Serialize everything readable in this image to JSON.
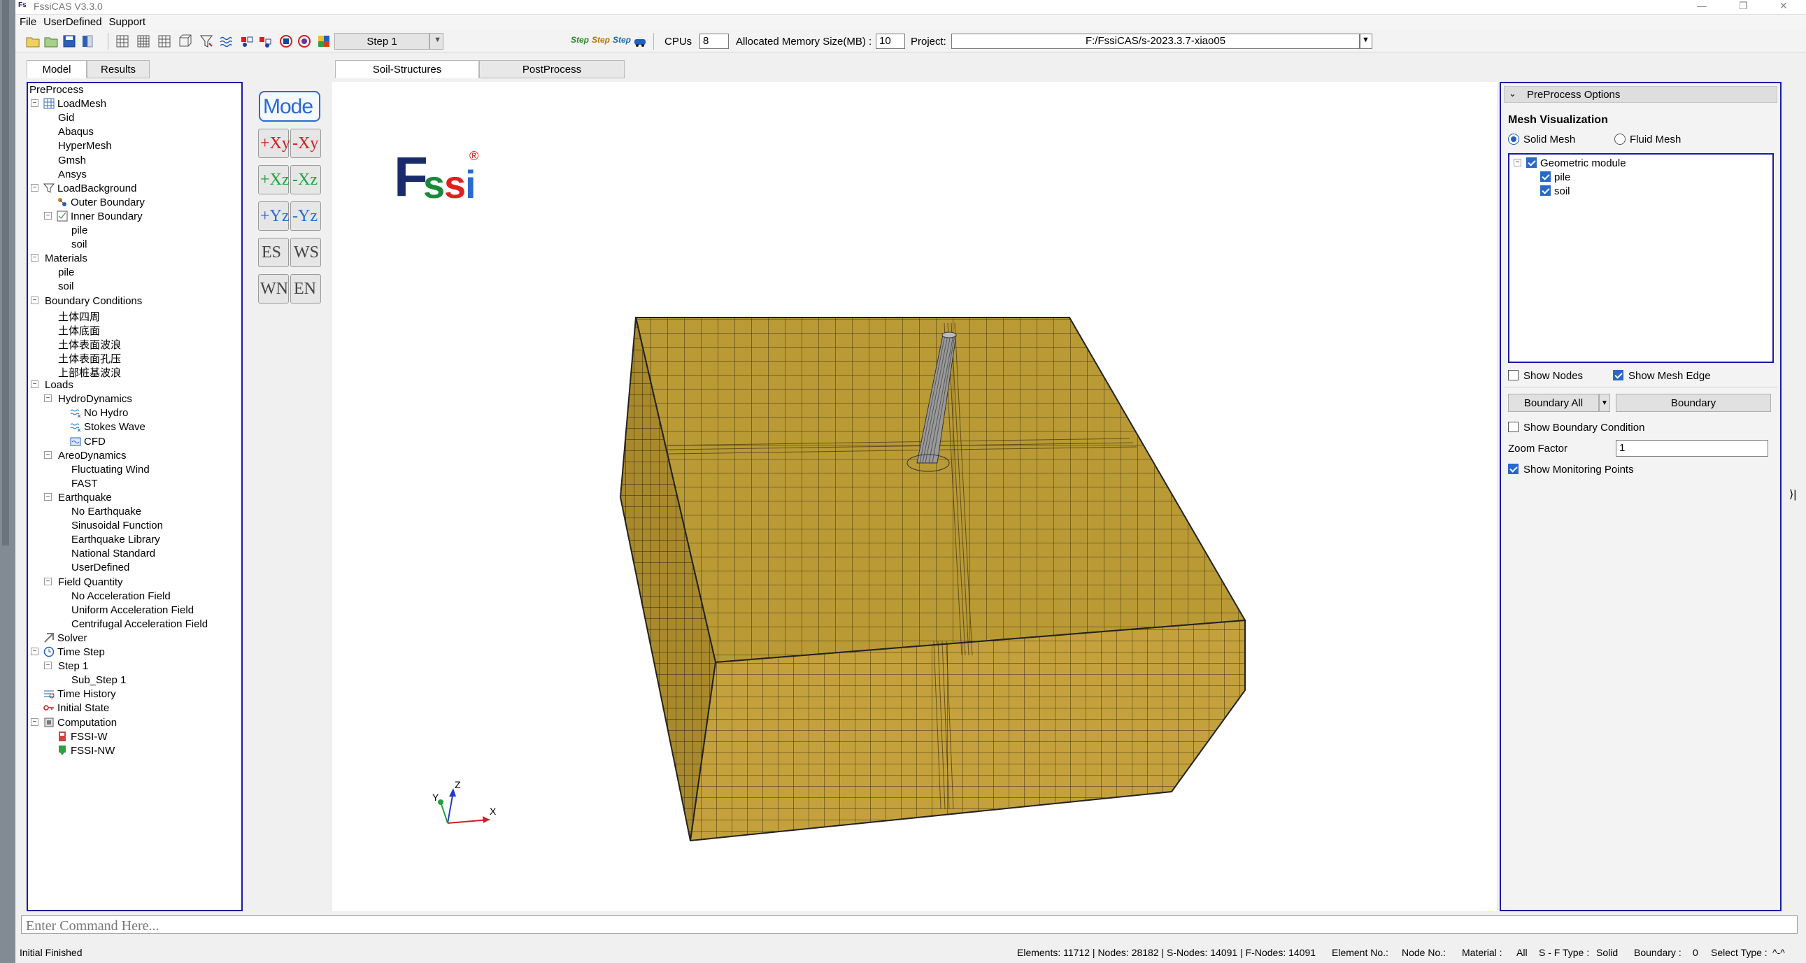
{
  "app": {
    "title": "FssiCAS V3.3.0"
  },
  "menu": [
    "File",
    "UserDefined",
    "Support"
  ],
  "toolbar": {
    "step_combo": "Step 1",
    "step_icons": [
      "Step",
      "Step",
      "Step"
    ],
    "cpus_label": "CPUs",
    "cpus_value": "8",
    "memory_label": "Allocated Memory Size(MB) :",
    "memory_value": "10",
    "project_label": "Project:",
    "project_path": "F:/FssiCAS/s-2023.3.7-xiao05"
  },
  "left_tabs": [
    "Model",
    "Results"
  ],
  "tree": [
    {
      "label": "PreProcess",
      "depth": 0,
      "exp": "",
      "icon": ""
    },
    {
      "label": "LoadMesh",
      "depth": 1,
      "exp": "-",
      "icon": "mesh-icon"
    },
    {
      "label": "Gid",
      "depth": 2,
      "exp": "",
      "icon": ""
    },
    {
      "label": "Abaqus",
      "depth": 2,
      "exp": "",
      "icon": ""
    },
    {
      "label": "HyperMesh",
      "depth": 2,
      "exp": "",
      "icon": ""
    },
    {
      "label": "Gmsh",
      "depth": 2,
      "exp": "",
      "icon": ""
    },
    {
      "label": "Ansys",
      "depth": 2,
      "exp": "",
      "icon": ""
    },
    {
      "label": "LoadBackground",
      "depth": 1,
      "exp": "-",
      "icon": "funnel-icon"
    },
    {
      "label": "Outer Boundary",
      "depth": 2,
      "exp": "",
      "icon": "boundary-icon"
    },
    {
      "label": "Inner Boundary",
      "depth": 2,
      "exp": "-",
      "icon": "inner-boundary-icon"
    },
    {
      "label": "pile",
      "depth": 3,
      "exp": "",
      "icon": ""
    },
    {
      "label": "soil",
      "depth": 3,
      "exp": "",
      "icon": ""
    },
    {
      "label": "Materials",
      "depth": 1,
      "exp": "-",
      "icon": ""
    },
    {
      "label": "pile",
      "depth": 2,
      "exp": "",
      "icon": ""
    },
    {
      "label": "soil",
      "depth": 2,
      "exp": "",
      "icon": ""
    },
    {
      "label": "Boundary Conditions",
      "depth": 1,
      "exp": "-",
      "icon": ""
    },
    {
      "label": "土体四周",
      "depth": 2,
      "exp": "",
      "icon": ""
    },
    {
      "label": "土体底面",
      "depth": 2,
      "exp": "",
      "icon": ""
    },
    {
      "label": "土体表面波浪",
      "depth": 2,
      "exp": "",
      "icon": ""
    },
    {
      "label": "土体表面孔压",
      "depth": 2,
      "exp": "",
      "icon": ""
    },
    {
      "label": "上部桩基波浪",
      "depth": 2,
      "exp": "",
      "icon": ""
    },
    {
      "label": "Loads",
      "depth": 1,
      "exp": "-",
      "icon": ""
    },
    {
      "label": "HydroDynamics",
      "depth": 2,
      "exp": "-",
      "icon": ""
    },
    {
      "label": "No Hydro",
      "depth": 3,
      "exp": "",
      "icon": "wave-icon"
    },
    {
      "label": "Stokes Wave",
      "depth": 3,
      "exp": "",
      "icon": "wave-icon"
    },
    {
      "label": "CFD",
      "depth": 3,
      "exp": "",
      "icon": "cfd-icon"
    },
    {
      "label": "AreoDynamics",
      "depth": 2,
      "exp": "-",
      "icon": ""
    },
    {
      "label": "Fluctuating Wind",
      "depth": 3,
      "exp": "",
      "icon": ""
    },
    {
      "label": "FAST",
      "depth": 3,
      "exp": "",
      "icon": ""
    },
    {
      "label": "Earthquake",
      "depth": 2,
      "exp": "-",
      "icon": ""
    },
    {
      "label": "No Earthquake",
      "depth": 3,
      "exp": "",
      "icon": ""
    },
    {
      "label": "Sinusoidal Function",
      "depth": 3,
      "exp": "",
      "icon": ""
    },
    {
      "label": "Earthquake Library",
      "depth": 3,
      "exp": "",
      "icon": ""
    },
    {
      "label": "National Standard",
      "depth": 3,
      "exp": "",
      "icon": ""
    },
    {
      "label": "UserDefined",
      "depth": 3,
      "exp": "",
      "icon": ""
    },
    {
      "label": "Field Quantity",
      "depth": 2,
      "exp": "-",
      "icon": ""
    },
    {
      "label": "No Acceleration Field",
      "depth": 3,
      "exp": "",
      "icon": ""
    },
    {
      "label": "Uniform Acceleration Field",
      "depth": 3,
      "exp": "",
      "icon": ""
    },
    {
      "label": "Centrifugal Acceleration Field",
      "depth": 3,
      "exp": "",
      "icon": ""
    },
    {
      "label": "Solver",
      "depth": 1,
      "exp": "",
      "icon": "solver-icon"
    },
    {
      "label": "Time Step",
      "depth": 1,
      "exp": "-",
      "icon": "clock-icon"
    },
    {
      "label": "Step 1",
      "depth": 2,
      "exp": "-",
      "icon": ""
    },
    {
      "label": "Sub_Step 1",
      "depth": 3,
      "exp": "",
      "icon": ""
    },
    {
      "label": "Time History",
      "depth": 1,
      "exp": "",
      "icon": "history-icon"
    },
    {
      "label": "Initial State",
      "depth": 1,
      "exp": "",
      "icon": "key-icon"
    },
    {
      "label": "Computation",
      "depth": 1,
      "exp": "-",
      "icon": "computation-icon"
    },
    {
      "label": "FSSI-W",
      "depth": 2,
      "exp": "",
      "icon": "fssi-w-icon"
    },
    {
      "label": "FSSI-NW",
      "depth": 2,
      "exp": "",
      "icon": "fssi-nw-icon"
    }
  ],
  "view_buttons": {
    "model": "Mode",
    "pairs": [
      [
        "+Xy",
        "-Xy"
      ],
      [
        "+Xz",
        "-Xz"
      ],
      [
        "+Yz",
        "-Yz"
      ],
      [
        "ES",
        "WS"
      ],
      [
        "WN",
        "EN"
      ]
    ]
  },
  "view_tabs": [
    "Soil-Structures",
    "PostProcess"
  ],
  "logo": {
    "text_f": "F",
    "text_s1": "s",
    "text_s2": "s",
    "text_i": "i",
    "mark": "®"
  },
  "axes": {
    "x": "X",
    "y": "Y",
    "z": "Z"
  },
  "right_panel": {
    "header": "PreProcess Options",
    "section_title": "Mesh Visualization",
    "radio_solid": "Solid Mesh",
    "radio_fluid": "Fluid Mesh",
    "geo_tree": {
      "root": "Geometric module",
      "children": [
        "pile",
        "soil"
      ]
    },
    "show_nodes": "Show Nodes",
    "show_mesh_edge": "Show Mesh Edge",
    "boundary_all": "Boundary All",
    "boundary_btn": "Boundary",
    "show_boundary_condition": "Show Boundary Condition",
    "zoom_label": "Zoom Factor",
    "zoom_value": "1",
    "show_monitoring": "Show Monitoring Points"
  },
  "command": {
    "placeholder": "Enter Command Here..."
  },
  "status": {
    "message": "Initial Finished",
    "stats": "Elements: 11712 | Nodes: 28182 | S-Nodes: 14091 | F-Nodes: 14091",
    "element_no": "Element No.:",
    "node_no": "Node No.:",
    "material": "Material :",
    "material_value": "All",
    "sf_type": "S - F Type :",
    "sf_value": "Solid",
    "boundary": "Boundary :",
    "boundary_value": "0",
    "select_type": "Select Type :",
    "select_value": "^-^"
  }
}
